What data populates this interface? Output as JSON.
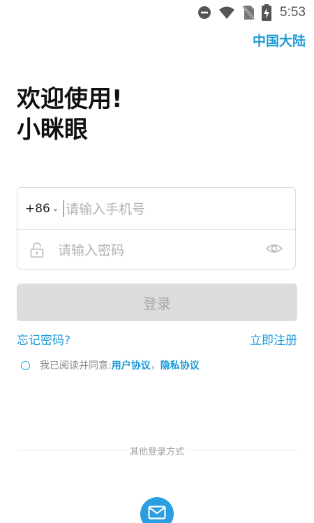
{
  "status_bar": {
    "time": "5:53",
    "icons": [
      "do-not-disturb-icon",
      "wifi-icon",
      "no-sim-icon",
      "battery-charging-icon"
    ]
  },
  "header": {
    "region": "中国大陆"
  },
  "welcome": {
    "line1": "欢迎使用!",
    "line2": "小眯眼"
  },
  "form": {
    "country_code": "+86",
    "phone_placeholder": "请输入手机号",
    "password_placeholder": "请输入密码"
  },
  "login_button": "登录",
  "links": {
    "forgot": "忘记密码?",
    "register": "立即注册"
  },
  "agreement": {
    "prefix": "我已阅读并同意:",
    "user_agreement": "用户协议",
    "separator": "，",
    "privacy_agreement": "隐私协议"
  },
  "other_login": {
    "label": "其他登录方式",
    "methods": [
      "email-icon"
    ]
  },
  "colors": {
    "accent": "#1d9bd6",
    "button_disabled": "#dddddd"
  }
}
